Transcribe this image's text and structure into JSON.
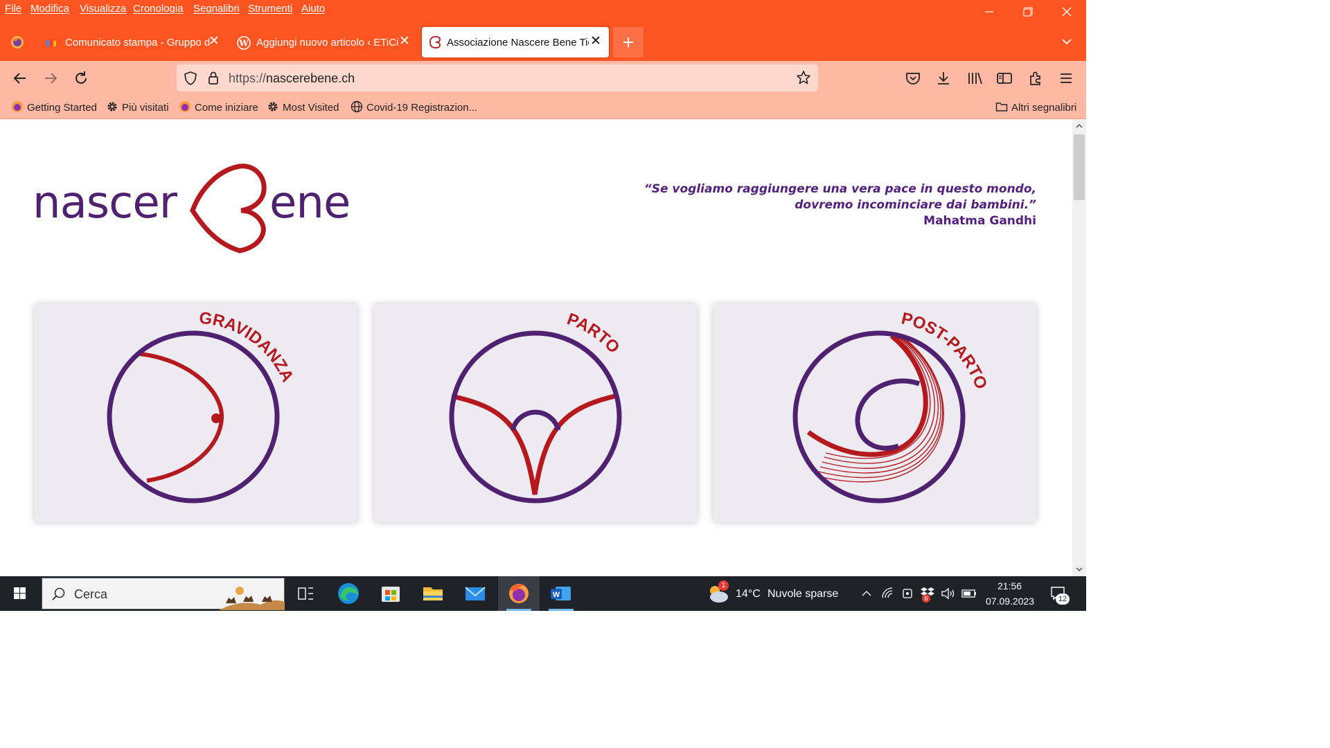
{
  "menu": [
    "File",
    "Modifica",
    "Visualizza",
    "Cronologia",
    "Segnalibri",
    "Strumenti",
    "Aiuto"
  ],
  "tabs": [
    {
      "title": "Comunicato stampa - Gruppo d"
    },
    {
      "title": "Aggiungi nuovo articolo ‹ ETiCi"
    },
    {
      "title": "Associazione Nascere Bene Ticin"
    }
  ],
  "url": {
    "protocol": "https://",
    "host": "nascerebene.ch"
  },
  "bookmarks": [
    {
      "label": "Getting Started",
      "icon": "firefox-icon"
    },
    {
      "label": "Più visitati",
      "icon": "gear-icon"
    },
    {
      "label": "Come iniziare",
      "icon": "firefox-icon"
    },
    {
      "label": "Most Visited",
      "icon": "gear-icon"
    },
    {
      "label": "Covid-19 Registrazion...",
      "icon": "globe-icon"
    }
  ],
  "other_bookmarks": "Altri segnalibri",
  "site": {
    "logo_left": "nascer",
    "logo_right": "ene",
    "quote_line1": "“Se vogliamo raggiungere una vera pace in questo mondo,",
    "quote_line2": "dovremo incominciare dai bambini.”",
    "quote_author": "Mahatma Gandhi",
    "cards": [
      {
        "label": "GRAVIDANZA"
      },
      {
        "label": "PARTO"
      },
      {
        "label": "POST-PARTO"
      }
    ]
  },
  "colors": {
    "browser_accent": "#fc5521",
    "toolbar": "#fdb9a3",
    "brand_purple": "#4f2170",
    "brand_red": "#b5191e"
  },
  "taskbar": {
    "search_placeholder": "Cerca",
    "weather_temp": "14°C",
    "weather_text": "Nuvole sparse",
    "weather_badge": "1",
    "time": "21:56",
    "date": "07.09.2023",
    "notifications": "12",
    "dropbox_badge": "6"
  }
}
